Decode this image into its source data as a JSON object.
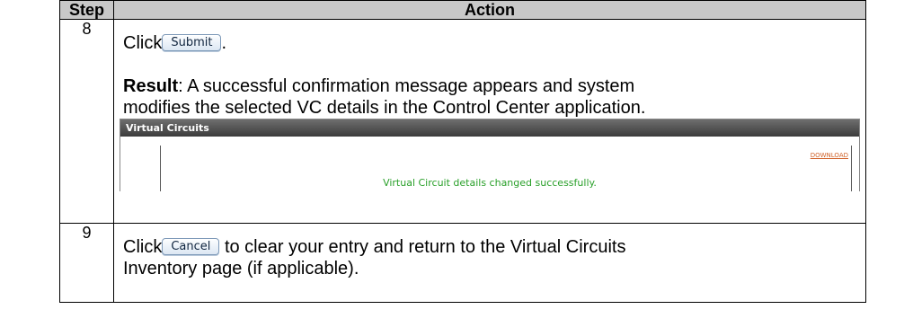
{
  "table": {
    "header_step": "Step",
    "header_action": "Action"
  },
  "rows": [
    {
      "step": "8",
      "click_word": "Click",
      "button_label": "Submit",
      "after_button": ".",
      "result_label": "Result",
      "result_text": ": A successful confirmation message appears and system",
      "result_text_2": "modifies the selected VC details in the Control Center application.",
      "panel": {
        "title": "Virtual Circuits",
        "download_link": "DOWNLOAD",
        "success_message": "Virtual Circuit details changed successfully."
      }
    },
    {
      "step": "9",
      "click_word": "Click",
      "button_label": "Cancel",
      "after_button": " to clear your entry and return to the Virtual Circuits",
      "after_button_2": "Inventory page (if applicable)."
    }
  ],
  "colors": {
    "header_bg": "#c8c8c8",
    "panel_title_bg": "#3c3c3c",
    "success_green": "#2aa02a",
    "download_orange": "#d0622a"
  }
}
